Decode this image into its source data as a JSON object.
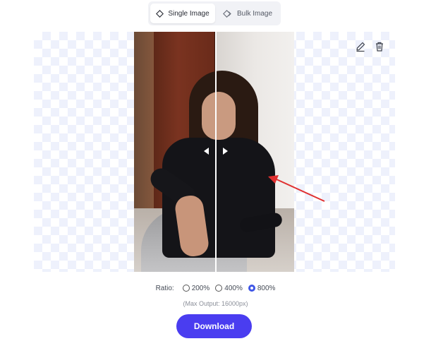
{
  "tabs": {
    "single_label": "Single Image",
    "bulk_label": "Bulk Image"
  },
  "icons": {
    "single": "diamond-outline-icon",
    "bulk": "layers-icon",
    "edit": "pencil-icon",
    "delete": "trash-icon",
    "compare_left": "chevron-left-icon",
    "compare_right": "chevron-right-icon",
    "annotation": "red-arrow-annotation"
  },
  "ratio": {
    "label": "Ratio:",
    "options": [
      {
        "label": "200%",
        "selected": false
      },
      {
        "label": "400%",
        "selected": false
      },
      {
        "label": "800%",
        "selected": true
      }
    ]
  },
  "max_output": "(Max Output: 16000px)",
  "download_label": "Download",
  "colors": {
    "accent": "#4a3df0",
    "radio_selected": "#3f56e6",
    "annotation": "#e03030"
  }
}
